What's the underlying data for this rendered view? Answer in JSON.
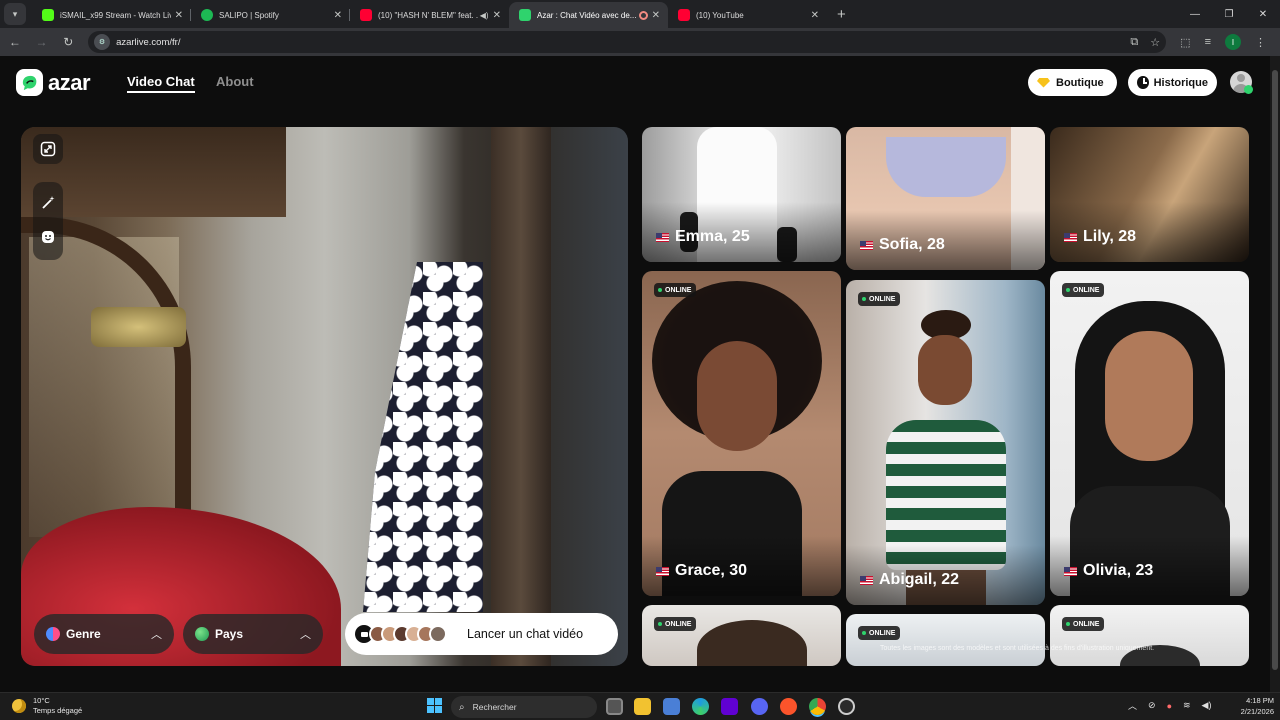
{
  "browser": {
    "tabs": [
      {
        "title": "iSMAIL_x99 Stream - Watch Live",
        "color": "#53fc18"
      },
      {
        "title": "SALIPO | Spotify",
        "color": "#1db954"
      },
      {
        "title": "(10) \"HASH N' BLEM\" feat. ...",
        "color": "#ff0033"
      },
      {
        "title": "Azar : Chat Vidéo avec de...",
        "color": "#2fd36d"
      },
      {
        "title": "(10) YouTube",
        "color": "#ff0033"
      }
    ],
    "url": "azarlive.com/fr/"
  },
  "header": {
    "logo": "azar",
    "nav": {
      "video_chat": "Video Chat",
      "about": "About"
    },
    "shop_label": "Boutique",
    "history_label": "Historique"
  },
  "video_panel": {
    "filters": {
      "gender": "Genre",
      "country": "Pays"
    },
    "start_label": "Lancer un chat vidéo"
  },
  "profiles": {
    "online_badge": "ONLINE",
    "row1": [
      {
        "name": "Emma, 25"
      },
      {
        "name": "Sofia, 28"
      },
      {
        "name": "Lily, 28"
      }
    ],
    "row2": [
      {
        "name": "Grace, 30"
      },
      {
        "name": "Abigail, 22"
      },
      {
        "name": "Olivia, 23"
      }
    ],
    "disclaimer": "Toutes les images sont des modèles et sont utilisées à des fins d'illustration uniquement."
  },
  "taskbar": {
    "temperature": "10°C",
    "weather": "Temps dégagé",
    "search_label": "Rechercher",
    "time": "4:18 PM",
    "date": "2/21/2026"
  },
  "colors": {
    "accent": "#2fd36d",
    "background": "#0d0d0d"
  }
}
